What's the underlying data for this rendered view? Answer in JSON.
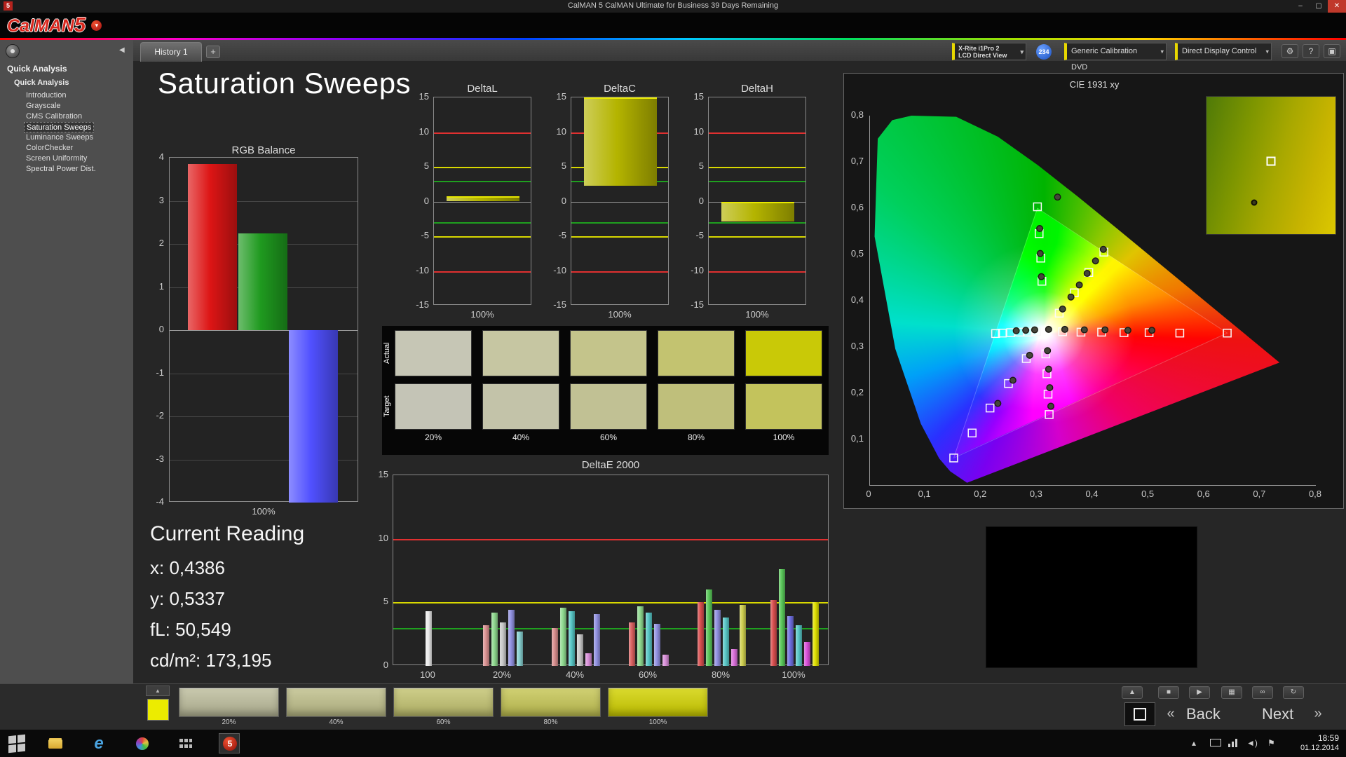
{
  "window": {
    "title": "CalMAN 5 CalMAN Ultimate for Business 39 Days Remaining",
    "logo_text": "CalMAN",
    "logo_number": "5",
    "tab_label": "History 1",
    "add_tab": "+",
    "meter_line1": "X-Rite i1Pro 2",
    "meter_line2": "LCD Direct View",
    "badge": "234",
    "source_label": "Generic Calibration DVD",
    "display_label": "Direct Display Control",
    "controls": {
      "minimize": "–",
      "maximize": "▢",
      "close": "✕"
    },
    "icons": {
      "gear": "⚙",
      "help": "?",
      "screen": "▣",
      "chevron": "▾",
      "collapse": "◀"
    }
  },
  "sidebar": {
    "header": "Quick Analysis",
    "root_label": "Quick Analysis",
    "items": [
      "Introduction",
      "Grayscale",
      "CMS Calibration",
      "Saturation Sweeps",
      "Luminance Sweeps",
      "ColorChecker",
      "Screen Uniformity",
      "Spectral Power Dist."
    ],
    "selected_index": 3
  },
  "page": {
    "title": "Saturation Sweeps"
  },
  "chart_data": [
    {
      "id": "rgb_balance",
      "type": "bar",
      "title": "RGB Balance",
      "categories": [
        "Red",
        "Green",
        "Blue"
      ],
      "values": [
        3.85,
        2.25,
        -4.0
      ],
      "colors": [
        "#dd1515",
        "#1f9a1f",
        "#5050ff"
      ],
      "xlabel": "100%",
      "ylim": [
        -4,
        4
      ],
      "yticks": [
        4,
        3,
        2,
        1,
        0,
        -1,
        -2,
        -3,
        -4
      ]
    },
    {
      "id": "deltaL",
      "type": "bar",
      "title": "DeltaL",
      "xlabel": "100%",
      "ylim": [
        -15,
        15
      ],
      "yticks": [
        15,
        10,
        5,
        0,
        -5,
        -10,
        -15
      ],
      "bar_span": [
        0,
        0.75
      ],
      "bar_color": "#b4b400",
      "ref_lines": [
        {
          "v": 10,
          "color": "#e03030"
        },
        {
          "v": 5,
          "color": "#d8d800"
        },
        {
          "v": 3,
          "color": "#1fa01f"
        },
        {
          "v": -3,
          "color": "#1fa01f"
        },
        {
          "v": -5,
          "color": "#d8d800"
        },
        {
          "v": -10,
          "color": "#e03030"
        }
      ]
    },
    {
      "id": "deltaC",
      "type": "bar",
      "title": "DeltaC",
      "xlabel": "100%",
      "ylim": [
        -15,
        15
      ],
      "yticks": [
        15,
        10,
        5,
        0,
        -5,
        -10,
        -15
      ],
      "bar_span": [
        2.3,
        15
      ],
      "bar_color": "#b4b400",
      "ref_lines": [
        {
          "v": 10,
          "color": "#e03030"
        },
        {
          "v": 5,
          "color": "#d8d800"
        },
        {
          "v": 3,
          "color": "#1fa01f"
        },
        {
          "v": -3,
          "color": "#1fa01f"
        },
        {
          "v": -5,
          "color": "#d8d800"
        },
        {
          "v": -10,
          "color": "#e03030"
        }
      ]
    },
    {
      "id": "deltaH",
      "type": "bar",
      "title": "DeltaH",
      "xlabel": "100%",
      "ylim": [
        -15,
        15
      ],
      "yticks": [
        15,
        10,
        5,
        0,
        -5,
        -10,
        -15
      ],
      "bar_span": [
        -2.9,
        0
      ],
      "bar_color": "#b4b400",
      "ref_lines": [
        {
          "v": 10,
          "color": "#e03030"
        },
        {
          "v": 5,
          "color": "#d8d800"
        },
        {
          "v": 3,
          "color": "#1fa01f"
        },
        {
          "v": -3,
          "color": "#1fa01f"
        },
        {
          "v": -5,
          "color": "#d8d800"
        },
        {
          "v": -10,
          "color": "#e03030"
        }
      ]
    },
    {
      "id": "deltae2000",
      "type": "grouped-bar",
      "title": "DeltaE 2000",
      "ylim": [
        0,
        15
      ],
      "yticks": [
        15,
        10,
        5,
        0
      ],
      "ref_lines": [
        {
          "v": 10,
          "color": "#e03030"
        },
        {
          "v": 5,
          "color": "#d8d800"
        },
        {
          "v": 3,
          "color": "#1fa01f"
        }
      ],
      "groups": [
        {
          "label": "100",
          "bars": [
            {
              "color": "#ececec",
              "value": 4.3
            }
          ]
        },
        {
          "label": "20%",
          "bars": [
            {
              "color": "#d99090",
              "value": 3.2
            },
            {
              "color": "#8fd98f",
              "value": 4.2
            },
            {
              "color": "#c8c8c8",
              "value": 3.4
            },
            {
              "color": "#9090e0",
              "value": 4.4
            },
            {
              "color": "#86cfcf",
              "value": 2.7
            }
          ]
        },
        {
          "label": "40%",
          "bars": [
            {
              "color": "#d98f8f",
              "value": 3.0
            },
            {
              "color": "#8fd98f",
              "value": 4.6
            },
            {
              "color": "#57c7c7",
              "value": 4.3
            },
            {
              "color": "#c8c8c8",
              "value": 2.5
            },
            {
              "color": "#d98fd9",
              "value": 1.0
            },
            {
              "color": "#9090e0",
              "value": 4.1
            }
          ]
        },
        {
          "label": "60%",
          "bars": [
            {
              "color": "#d96060",
              "value": 3.4
            },
            {
              "color": "#8fd98f",
              "value": 4.7
            },
            {
              "color": "#57c7c7",
              "value": 4.2
            },
            {
              "color": "#9090e0",
              "value": 3.3
            },
            {
              "color": "#d98fd9",
              "value": 0.9
            }
          ]
        },
        {
          "label": "80%",
          "bars": [
            {
              "color": "#d94f4f",
              "value": 5.0
            },
            {
              "color": "#59c759",
              "value": 6.0
            },
            {
              "color": "#9090e0",
              "value": 4.4
            },
            {
              "color": "#57c7c7",
              "value": 3.8
            },
            {
              "color": "#d96fd9",
              "value": 1.3
            },
            {
              "color": "#cfcf4f",
              "value": 4.8
            }
          ]
        },
        {
          "label": "100%",
          "bars": [
            {
              "color": "#d94f4f",
              "value": 5.2
            },
            {
              "color": "#59c759",
              "value": 7.6
            },
            {
              "color": "#6f6fe0",
              "value": 3.9
            },
            {
              "color": "#57c7c7",
              "value": 3.2
            },
            {
              "color": "#d94fd9",
              "value": 1.9
            },
            {
              "color": "#e0e000",
              "value": 5.0
            }
          ]
        }
      ]
    }
  ],
  "swatch_table": {
    "row_labels": [
      "Actual",
      "Target"
    ],
    "col_labels": [
      "20%",
      "40%",
      "60%",
      "80%",
      "100%"
    ],
    "actual_colors": [
      "#c6c6b5",
      "#c6c6a2",
      "#c4c48b",
      "#c3c370",
      "#c9c907"
    ],
    "target_colors": [
      "#c4c4b6",
      "#c3c3a9",
      "#c1c194",
      "#bfbf7b",
      "#c3c35c"
    ]
  },
  "current_reading": {
    "title": "Current Reading",
    "lines": [
      "x: 0,4386",
      "y: 0,5337",
      "fL: 50,549",
      "cd/m²: 173,195"
    ]
  },
  "cie": {
    "title": "CIE 1931 xy",
    "x_ticks": [
      "0",
      "0,1",
      "0,2",
      "0,3",
      "0,4",
      "0,5",
      "0,6",
      "0,7",
      "0,8"
    ],
    "y_ticks": [
      "0,8",
      "0,7",
      "0,6",
      "0,5",
      "0,4",
      "0,3",
      "0,2",
      "0,1"
    ],
    "axis_range": [
      0,
      0.8
    ],
    "white_point": [
      0.3127,
      0.329
    ],
    "gamut_triangle": [
      [
        0.64,
        0.33
      ],
      [
        0.3,
        0.6
      ],
      [
        0.15,
        0.06
      ]
    ],
    "target_points": [
      [
        0.345,
        0.333
      ],
      [
        0.378,
        0.332
      ],
      [
        0.415,
        0.332
      ],
      [
        0.455,
        0.331
      ],
      [
        0.5,
        0.331
      ],
      [
        0.555,
        0.33
      ],
      [
        0.64,
        0.33
      ],
      [
        0.298,
        0.333
      ],
      [
        0.283,
        0.332
      ],
      [
        0.268,
        0.332
      ],
      [
        0.252,
        0.331
      ],
      [
        0.237,
        0.33
      ],
      [
        0.225,
        0.329
      ],
      [
        0.308,
        0.442
      ],
      [
        0.306,
        0.492
      ],
      [
        0.303,
        0.545
      ],
      [
        0.3,
        0.603
      ],
      [
        0.28,
        0.275
      ],
      [
        0.248,
        0.221
      ],
      [
        0.215,
        0.168
      ],
      [
        0.183,
        0.114
      ],
      [
        0.15,
        0.06
      ],
      [
        0.315,
        0.285
      ],
      [
        0.317,
        0.242
      ],
      [
        0.319,
        0.198
      ],
      [
        0.321,
        0.154
      ],
      [
        0.339,
        0.373
      ],
      [
        0.366,
        0.417
      ],
      [
        0.392,
        0.461
      ],
      [
        0.419,
        0.505
      ]
    ],
    "measured_points": [
      [
        0.349,
        0.338
      ],
      [
        0.384,
        0.337
      ],
      [
        0.421,
        0.337
      ],
      [
        0.462,
        0.336
      ],
      [
        0.505,
        0.336
      ],
      [
        0.295,
        0.337
      ],
      [
        0.279,
        0.336
      ],
      [
        0.262,
        0.335
      ],
      [
        0.307,
        0.452
      ],
      [
        0.305,
        0.502
      ],
      [
        0.304,
        0.556
      ],
      [
        0.336,
        0.624
      ],
      [
        0.345,
        0.382
      ],
      [
        0.36,
        0.408
      ],
      [
        0.375,
        0.434
      ],
      [
        0.389,
        0.459
      ],
      [
        0.404,
        0.486
      ],
      [
        0.418,
        0.511
      ],
      [
        0.318,
        0.292
      ],
      [
        0.32,
        0.252
      ],
      [
        0.322,
        0.212
      ],
      [
        0.324,
        0.172
      ],
      [
        0.286,
        0.282
      ],
      [
        0.256,
        0.228
      ],
      [
        0.229,
        0.178
      ],
      [
        0.32,
        0.338
      ]
    ]
  },
  "bottom_bar": {
    "swatches": [
      {
        "label": "20%",
        "color": "#bdbd9c"
      },
      {
        "label": "40%",
        "color": "#bfbf8a"
      },
      {
        "label": "60%",
        "color": "#c3c370"
      },
      {
        "label": "80%",
        "color": "#c6c654"
      },
      {
        "label": "100%",
        "color": "#d2d200"
      }
    ],
    "current_color": "#ecec00",
    "transport": [
      {
        "name": "eject",
        "glyph": "▲"
      },
      {
        "name": "stop",
        "glyph": "■"
      },
      {
        "name": "play",
        "glyph": "▶"
      },
      {
        "name": "save",
        "glyph": "▦"
      },
      {
        "name": "loop",
        "glyph": "∞"
      },
      {
        "name": "refresh",
        "glyph": "↻"
      }
    ],
    "prev_chevron": "«",
    "back_label": "Back",
    "next_label": "Next",
    "next_chevron": "»"
  },
  "taskbar": {
    "apps": [
      "start",
      "file-explorer",
      "internet-explorer",
      "color-app",
      "grid-app",
      "calman"
    ],
    "tray_icons": [
      "hidden-icons",
      "display",
      "network",
      "volume",
      "action-center"
    ],
    "time": "18:59",
    "date": "01.12.2014"
  }
}
